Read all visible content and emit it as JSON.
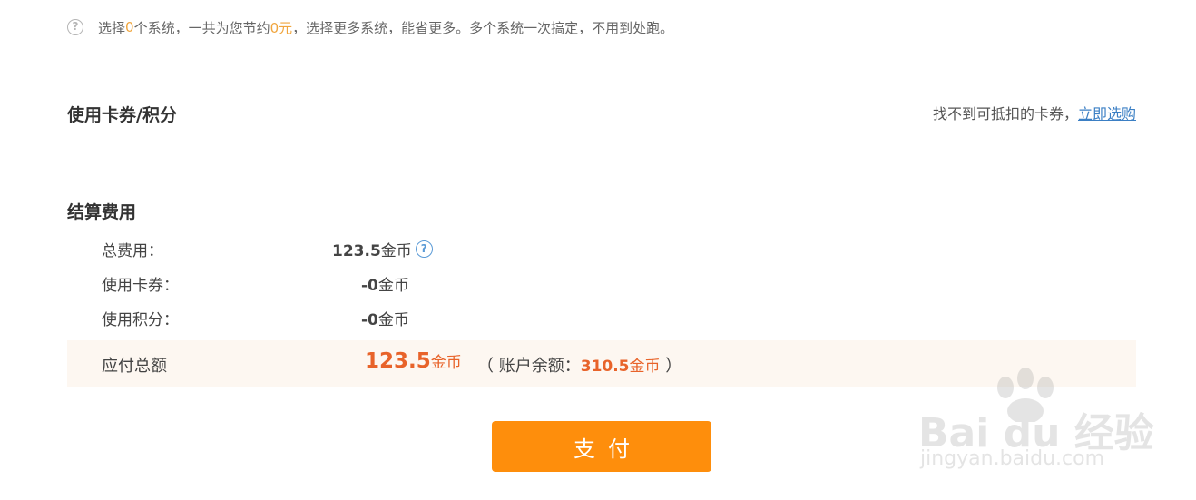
{
  "info": {
    "prefix": "选择",
    "count": "0",
    "mid": "个系统，一共为您节约",
    "saved": "0元",
    "suffix": "，选择更多系统，能省更多。多个系统一次搞定，不用到处跑。"
  },
  "coupon": {
    "title": "使用卡券/积分",
    "hint": "找不到可抵扣的卡券，",
    "link": "立即选购"
  },
  "settlement": {
    "title": "结算费用",
    "rows": [
      {
        "label": "总费用：",
        "amount": "123.5",
        "unit": "金币"
      },
      {
        "label": "使用卡券：",
        "amount": "-0",
        "unit": "金币"
      },
      {
        "label": "使用积分：",
        "amount": "-0",
        "unit": "金币"
      }
    ],
    "total": {
      "label": "应付总额",
      "amount": "123.5",
      "unit": "金币",
      "balance_prefix": "（ 账户余额：",
      "balance_amount": "310.5",
      "balance_unit": "金币",
      "balance_suffix": " ）"
    }
  },
  "pay_button": "支付",
  "watermark": {
    "main": "Bai du 经验",
    "sub": "jingyan.baidu.com"
  },
  "colors": {
    "accent_orange": "#fe8e0c",
    "amount_red": "#e8632a",
    "highlight": "#f0a53d",
    "link_blue": "#3b7fc4"
  }
}
